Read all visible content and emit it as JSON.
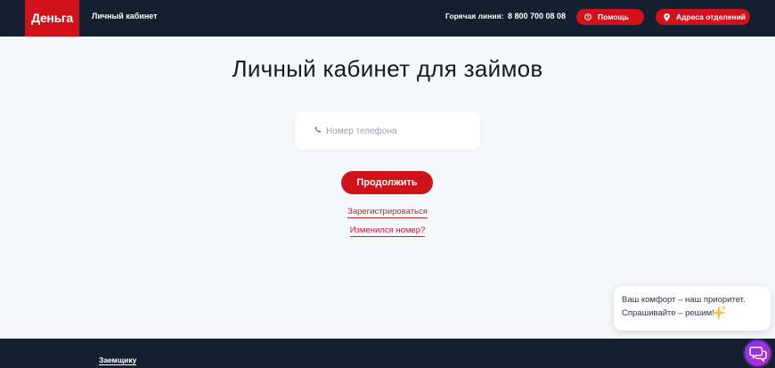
{
  "header": {
    "logo_text": "Деньга",
    "cabinet_link": "Личный кабинет",
    "hotline_label": "Горячая линия:",
    "hotline_number": "8 800 700 08 08",
    "help_button": "Помощь",
    "address_button": "Адреса отделений"
  },
  "main": {
    "title": "Личный кабинет для займов",
    "phone_placeholder": "Номер телефона",
    "continue_button": "Продолжить",
    "register_link": "Зарегистрироваться",
    "changed_number_link": "Изменился номер?"
  },
  "footer": {
    "borrower_link": "Заемщику"
  },
  "chat": {
    "line1": "Ваш комфорт – наш приоритет.",
    "line2": "Спрашивайте – решим!",
    "sparkle_icon": "sparkles-icon",
    "fab_icon": "chat-bubbles-icon"
  },
  "colors": {
    "brand_red": "#d1121a",
    "header_bg": "#14202f",
    "page_bg": "#f4f8fb",
    "link_red": "#c4242b"
  }
}
